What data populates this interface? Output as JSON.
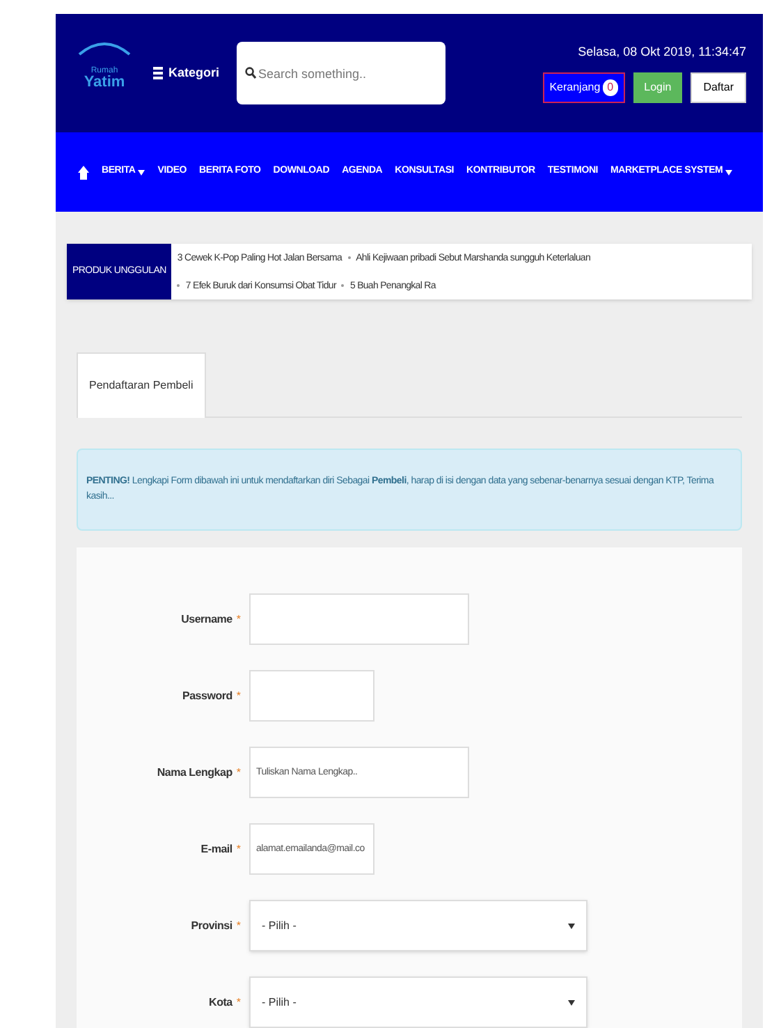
{
  "logo": {
    "line_1": "Rumah",
    "line_2": "Yatim"
  },
  "category_button": {
    "label": "Kategori"
  },
  "search": {
    "placeholder": "Search something.."
  },
  "datetime": "Selasa, 08 Okt 2019, 11:34:47",
  "cart": {
    "label": "Keranjang",
    "count": "0"
  },
  "auth_buttons": [
    {
      "label": "Login",
      "kind": "primary"
    },
    {
      "label": "Daftar",
      "kind": "plain"
    }
  ],
  "nav": [
    {
      "label": "BERITA",
      "dropdown": true
    },
    {
      "label": "VIDEO",
      "dropdown": false
    },
    {
      "label": "BERITA FOTO",
      "dropdown": false
    },
    {
      "label": "DOWNLOAD",
      "dropdown": false
    },
    {
      "label": "AGENDA",
      "dropdown": false
    },
    {
      "label": "KONSULTASI",
      "dropdown": false
    },
    {
      "label": "KONTRIBUTOR",
      "dropdown": false
    },
    {
      "label": "TESTIMONI",
      "dropdown": false
    },
    {
      "label": "MARKETPLACE SYSTEM",
      "dropdown": true
    }
  ],
  "ticker": {
    "label": "PRODUK UNGGULAN",
    "items": [
      "3 Cewek K-Pop Paling Hot Jalan Bersama",
      "Ahli Kejiwaan pribadi Sebut Marshanda sungguh Keterlaluan",
      "7 Efek Buruk dari Konsumsi Obat Tidur",
      "5 Buah Penangkal Ra"
    ]
  },
  "tabs": [
    {
      "label": "Pendaftaran Pembeli",
      "selected": true
    }
  ],
  "alert": "**PENTING!** Lengkapi Form dibawah ini untuk mendaftarkan diri Sebagai **Pembeli**, harap di isi dengan data yang sebenar-benarnya sesuai dengan KTP, Terima kasih...",
  "form": [
    {
      "label": "Username",
      "required_mark": "*",
      "kind": "text"
    },
    {
      "label": "Password",
      "required_mark": "*",
      "kind": "text"
    },
    {
      "label": "Nama Lengkap",
      "required_mark": "*",
      "kind": "text",
      "placeholder": "Tuliskan Nama Lengkap.."
    },
    {
      "label": "E-mail",
      "required_mark": "*",
      "kind": "text",
      "placeholder": "alamat.emailanda@mail.co"
    },
    {
      "label": "Provinsi",
      "required_mark": "*",
      "kind": "select",
      "value": "- Pilih -"
    },
    {
      "label": "Kota",
      "required_mark": "*",
      "kind": "select",
      "value": "- Pilih -"
    }
  ]
}
